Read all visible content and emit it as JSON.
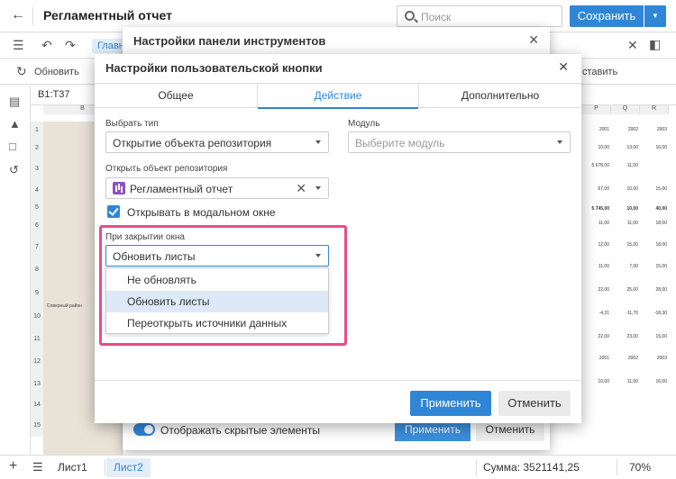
{
  "header": {
    "title": "Регламентный отчет",
    "search_placeholder": "Поиск",
    "save_label": "Сохранить"
  },
  "ribbon": {
    "tab_main": "Главн",
    "refresh_label": "Обновить",
    "insert_label": "ставить"
  },
  "grid": {
    "cell_ref": "B1:T37",
    "col_headers": [
      "B",
      "P",
      "Q",
      "R"
    ],
    "row_numbers": [
      "1",
      "2",
      "3",
      "4",
      "5",
      "6",
      "7",
      "8",
      "9",
      "10",
      "11",
      "12",
      "13",
      "14",
      "15"
    ],
    "region_label": "Северный район",
    "right_values": [
      [
        "2001",
        "2002",
        "2003"
      ],
      [
        "10,00",
        "13,00",
        "16,00"
      ],
      [
        "5 678,00",
        "11,00",
        ""
      ],
      [
        "67,00",
        "10,00",
        "15,00"
      ],
      [
        "5 745,00",
        "10,00",
        "40,00"
      ],
      [
        "11,00",
        "11,00",
        "18,00"
      ],
      [
        "12,00",
        "15,00",
        "18,00"
      ],
      [
        "11,00",
        "7,00",
        "15,00"
      ],
      [
        "22,00",
        "25,00",
        "28,00"
      ],
      [
        "-4,31",
        "-11,70",
        "-18,30"
      ],
      [
        "22,00",
        "23,00",
        "15,00"
      ],
      [
        "2001",
        "2002",
        "2003"
      ],
      [
        "10,00",
        "11,00",
        "16,00"
      ],
      [
        "",
        "",
        ""
      ],
      [
        "",
        "",
        ""
      ]
    ]
  },
  "toolbar_dialog": {
    "title": "Настройки панели инструментов",
    "show_hidden_label": "Отображать скрытые элементы",
    "apply_label": "Применить",
    "cancel_label": "Отменить"
  },
  "button_dialog": {
    "title": "Настройки пользовательской кнопки",
    "tabs": [
      "Общее",
      "Действие",
      "Дополнительно"
    ],
    "type_label": "Выбрать тип",
    "type_value": "Открытие объекта репозитория",
    "module_label": "Модуль",
    "module_placeholder": "Выберите модуль",
    "repo_label": "Открыть объект репозитория",
    "repo_value": "Регламентный отчет",
    "modal_checkbox_label": "Открывать в модальном окне",
    "on_close_label": "При закрытии окна",
    "on_close_value": "Обновить листы",
    "on_close_options": [
      "Не обновлять",
      "Обновить листы",
      "Переоткрыть источники данных"
    ],
    "apply_label": "Применить",
    "cancel_label": "Отменить"
  },
  "statusbar": {
    "sheets": [
      "Лист1",
      "Лист2"
    ],
    "sum": "Сумма: 3521141,25",
    "zoom": "70%"
  },
  "colors": {
    "accent": "#2f86d6",
    "highlight": "#e94b8a"
  }
}
